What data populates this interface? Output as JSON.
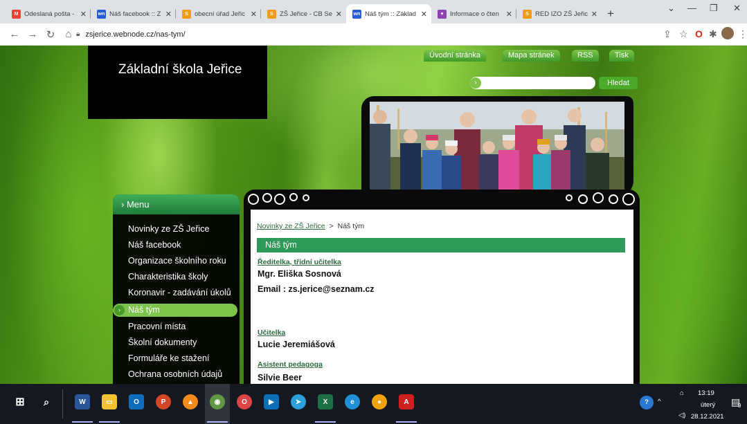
{
  "browser": {
    "tabs": [
      {
        "title": "Odeslaná pošta -",
        "favicon": "gmail-icon",
        "color": "#ea4335",
        "glyph": "M",
        "active": false
      },
      {
        "title": "Náš facebook :: Z",
        "favicon": "webnode-icon",
        "color": "#2a5bd7",
        "glyph": "wn",
        "active": false
      },
      {
        "title": "obecní úřad Jeřic",
        "favicon": "search-engine-icon",
        "color": "#f39c12",
        "glyph": "S",
        "active": false
      },
      {
        "title": "ZŠ Jeřice - CB Se",
        "favicon": "search-engine-icon",
        "color": "#f39c12",
        "glyph": "S",
        "active": false
      },
      {
        "title": "Náš tým :: Základ",
        "favicon": "webnode-icon",
        "color": "#2a5bd7",
        "glyph": "wn",
        "active": true
      },
      {
        "title": "Informace o čten",
        "favicon": "heart-icon",
        "color": "#8e44ad",
        "glyph": "♥",
        "active": false
      },
      {
        "title": "RED IZO ZŠ Jeřic",
        "favicon": "search-engine-icon",
        "color": "#f39c12",
        "glyph": "S",
        "active": false
      }
    ],
    "new_tab": "+",
    "url": "zsjerice.webnode.cz/nas-tym/"
  },
  "site": {
    "title": "Základní škola Jeřice",
    "topnav": [
      "Úvodní stránka",
      "Mapa stránek",
      "RSS",
      "Tisk"
    ],
    "search_button": "Hledat",
    "search_placeholder": ""
  },
  "sidebar": {
    "heading": "› Menu",
    "items": [
      "Novinky ze ZŠ Jeřice",
      "Náš facebook",
      "Organizace školního roku",
      "Charakteristika školy",
      "Koronavir - zadávání úkolů",
      "Náš tým",
      "Pracovní místa",
      "Školní dokumenty",
      "Formuláře ke stažení",
      "Ochrana osobních údajů"
    ],
    "active_index": 5
  },
  "content": {
    "breadcrumb_link": "Novinky ze ZŠ Jeřice",
    "breadcrumb_sep": ">",
    "breadcrumb_current": "Náš tým",
    "section_title": "Náš tým",
    "roles": [
      {
        "role": "Ředitelka, třídní učitelka",
        "lines": [
          "Mgr. Eliška Sosnová",
          "Email : zs.jerice@seznam.cz"
        ]
      },
      {
        "role": "Učitelka",
        "lines": [
          "Lucie Jeremiášová"
        ]
      },
      {
        "role": "Asistent pedagoga",
        "lines": [
          "Silvie Beer"
        ]
      }
    ]
  },
  "taskbar": {
    "time": "13:19",
    "day": "úterý",
    "date": "28.12.2021",
    "notification_count": "9"
  },
  "colors": {
    "accent_green": "#2f9a57",
    "nav_green": "#7cc44a"
  }
}
